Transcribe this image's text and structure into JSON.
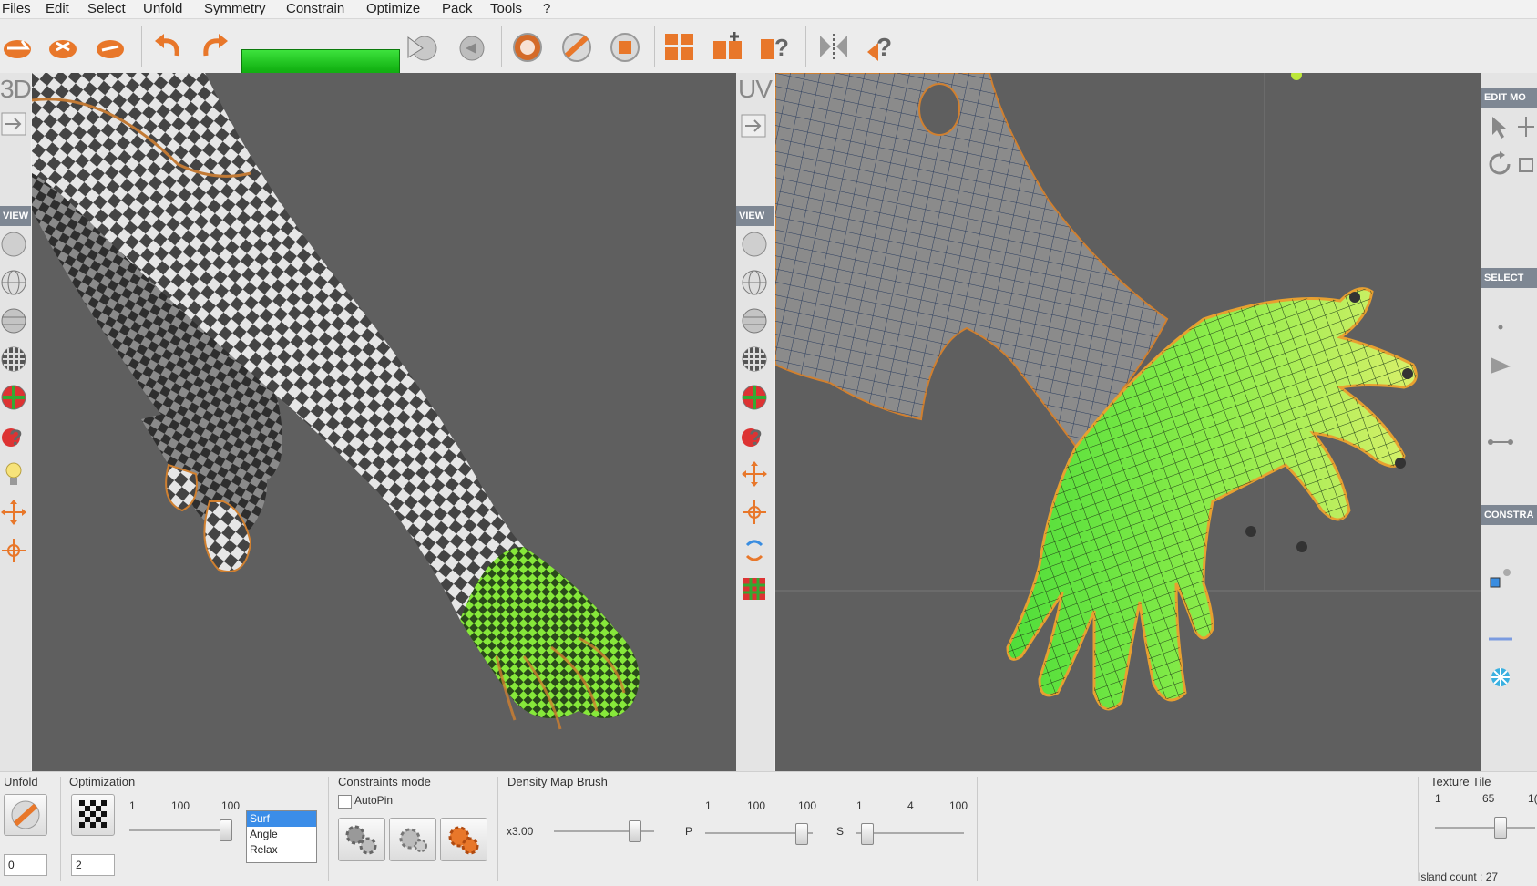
{
  "menu": [
    "Files",
    "Edit",
    "Select",
    "Unfold",
    "Symmetry",
    "Constrain",
    "Optimize",
    "Pack",
    "Tools",
    "?"
  ],
  "toolbar": {
    "icons": [
      "open-icon",
      "import-icon",
      "export-icon",
      "undo-icon",
      "redo-icon",
      "play-icon",
      "reset-icon",
      "checker-icon",
      "unfold-icon",
      "stop-icon",
      "pack-icon",
      "pack-add-icon",
      "pack-help-icon",
      "mirror-icon",
      "help-icon"
    ],
    "progress": 1.0
  },
  "left_strip": {
    "label": "3D",
    "view_header": "VIEW"
  },
  "mid_strip": {
    "label": "UV",
    "view_header": "VIEW"
  },
  "right_panel": {
    "headers": [
      "EDIT MO",
      "SELECT",
      "CONSTRA"
    ]
  },
  "bottom": {
    "unfold": {
      "label": "Unfold",
      "spin_value": "0"
    },
    "optimization": {
      "label": "Optimization",
      "ticks": [
        "1",
        "100",
        "100"
      ],
      "spin_value": "2",
      "list": [
        "Surf",
        "Angle",
        "Relax"
      ],
      "selected": "Surf"
    },
    "constraints": {
      "label": "Constraints mode",
      "autopin": "AutoPin",
      "autopin_checked": false
    },
    "density": {
      "label": "Density Map Brush",
      "multiplier": "x3.00",
      "ticks_a": [
        "1",
        "100",
        "100"
      ],
      "ticks_b": [
        "1",
        "4",
        "100"
      ],
      "p_label": "P",
      "s_label": "S"
    },
    "texture_tile": {
      "label": "Texture Tile",
      "ticks": [
        "1",
        "65",
        "1("
      ]
    },
    "island_count": "Island count : 27"
  }
}
